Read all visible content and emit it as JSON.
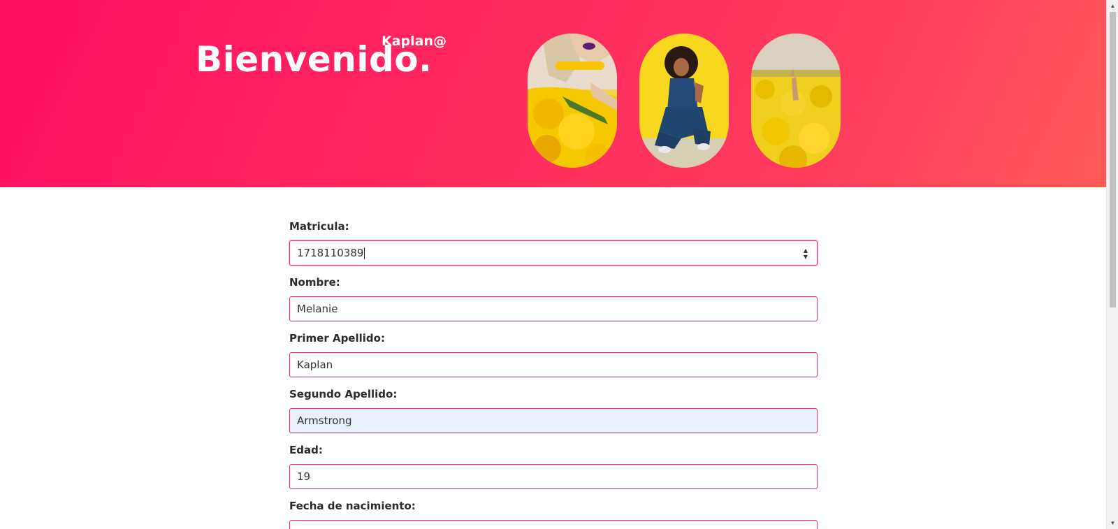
{
  "header": {
    "title": "Bienvenido.",
    "badge": "Kaplan@",
    "photos": [
      {
        "icon": "woman-with-yellow-flowers-photo"
      },
      {
        "icon": "woman-crouching-yellow-background-photo"
      },
      {
        "icon": "hand-in-yellow-field-photo"
      }
    ]
  },
  "form": {
    "matricula": {
      "label": "Matricula:",
      "value": "1718110389"
    },
    "nombre": {
      "label": "Nombre:",
      "value": "Melanie"
    },
    "primer_apellido": {
      "label": "Primer Apellido:",
      "value": "Kaplan"
    },
    "segundo_apellido": {
      "label": "Segundo Apellido:",
      "value": "Armstrong"
    },
    "edad": {
      "label": "Edad:",
      "value": "19"
    },
    "fecha_nacimiento": {
      "label": "Fecha de nacimiento:",
      "value": ""
    }
  },
  "colors": {
    "accent": "#ff2a5e",
    "gradient_start": "#ff0f62",
    "gradient_end": "#ff5a57",
    "autofill_bg": "#e8f0fe"
  }
}
